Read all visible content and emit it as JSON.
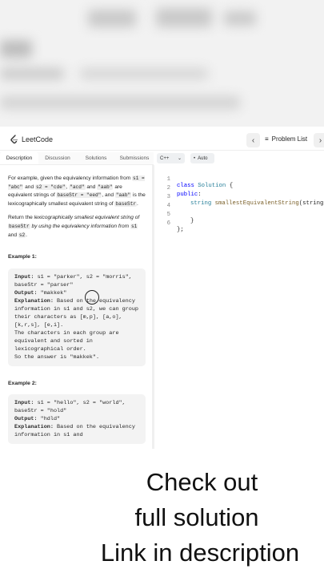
{
  "header": {
    "logo_text": "LeetCode",
    "problem_list_label": "Problem List",
    "prev_icon": "‹",
    "next_icon": "›"
  },
  "tabs": [
    {
      "label": "Description",
      "active": true
    },
    {
      "label": "Discussion",
      "active": false
    },
    {
      "label": "Solutions",
      "active": false
    },
    {
      "label": "Submissions",
      "active": false
    }
  ],
  "editor_toolbar": {
    "language": "C++",
    "auto_label": "Auto"
  },
  "description": {
    "p1_a": "For example, given the equivalency information from ",
    "p1_c1": "s1 = \"abc\"",
    "p1_b": " and ",
    "p1_c2": "s2 = \"cde\"",
    "p1_c": ", ",
    "p1_c3": "\"acd\"",
    "p1_d": " and ",
    "p1_c4": "\"aab\"",
    "p1_e": " are equivalent strings of ",
    "p1_c5": "baseStr = \"eed\"",
    "p1_f": ", and ",
    "p1_c6": "\"aab\"",
    "p1_g": " is the lexicographically smallest equivalent string of ",
    "p1_c7": "baseStr",
    "p1_h": ".",
    "p2_a": "Return the ",
    "p2_i1": "lexicographically smallest equivalent string of ",
    "p2_c1": "baseStr",
    "p2_i2": " by using the equivalency information from ",
    "p2_c2": "s1",
    "p2_b": " and ",
    "p2_c3": "s2",
    "p2_c": ".",
    "example1_title": "Example 1:",
    "example1": {
      "input_label": "Input:",
      "input_value": " s1 = \"parker\", s2 = \"morris\", baseStr = \"parser\"",
      "output_label": "Output:",
      "output_value": " \"makkek\"",
      "explanation_label": "Explanation:",
      "explanation_value": " Based on the equivalency information in s1 and s2, we can group their characters as [m,p], [a,o], [k,r,s], [e,i].\nThe characters in each group are equivalent and sorted in lexicographical order.\nSo the answer is \"makkek\"."
    },
    "example2_title": "Example 2:",
    "example2": {
      "input_label": "Input:",
      "input_value": " s1 = \"hello\", s2 = \"world\", baseStr = \"hold\"",
      "output_label": "Output:",
      "output_value": " \"hdld\"",
      "explanation_label": "Explanation:",
      "explanation_value": " Based on the equivalency information in s1 and"
    }
  },
  "code": {
    "line_numbers": [
      "1",
      "2",
      "3",
      "4",
      "5",
      "6"
    ],
    "l1_kw": "class",
    "l1_name": " Solution",
    "l1_rest": " {",
    "l2_kw": "public",
    "l2_rest": ":",
    "l3_type": "string",
    "l3_fn": " smallestEquivalentString",
    "l3_rest": "(string s",
    "l4": "",
    "l5": "}",
    "l6": "};"
  },
  "promo": {
    "line1": "Check out",
    "line2": "full solution",
    "line3": "Link in description"
  }
}
